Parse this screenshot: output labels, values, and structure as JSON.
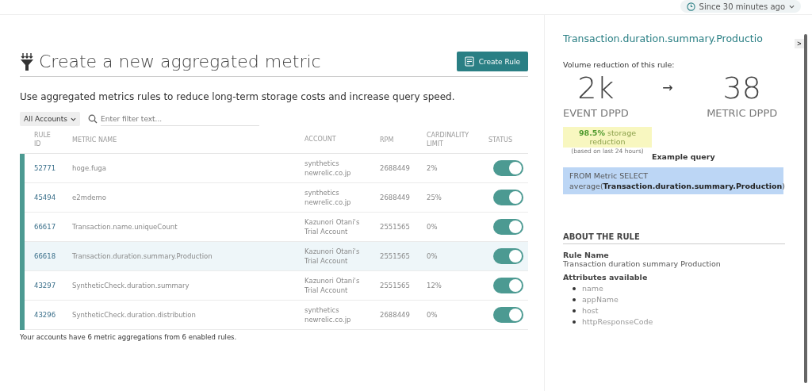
{
  "time_picker": {
    "label": "Since 30 minutes ago"
  },
  "header": {
    "title": "Create a new aggregated metric",
    "create_button": "Create Rule"
  },
  "description": "Use aggregated metrics rules to reduce long-term storage costs and increase query speed.",
  "filters": {
    "account_dropdown": "All Accounts",
    "search": {
      "placeholder": "Enter filter text..."
    }
  },
  "table": {
    "columns": [
      "RULE ID",
      "METRIC NAME",
      "ACCOUNT",
      "RPM",
      "CARDINALITY LIMIT",
      "STATUS"
    ],
    "rows": [
      {
        "rule_id": "52771",
        "metric_name": "hoge.fuga",
        "account": [
          "synthetics",
          "newrelic.co.jp"
        ],
        "rpm": "2688449",
        "cardinality_limit": "2%",
        "enabled": true,
        "selected": false
      },
      {
        "rule_id": "45494",
        "metric_name": "e2mdemo",
        "account": [
          "synthetics",
          "newrelic.co.jp"
        ],
        "rpm": "2688449",
        "cardinality_limit": "25%",
        "enabled": true,
        "selected": false
      },
      {
        "rule_id": "66617",
        "metric_name": "Transaction.name.uniqueCount",
        "account": [
          "Kazunori Otani's",
          "Trial Account"
        ],
        "rpm": "2551565",
        "cardinality_limit": "0%",
        "enabled": true,
        "selected": false
      },
      {
        "rule_id": "66618",
        "metric_name": "Transaction.duration.summary.Production",
        "account": [
          "Kazunori Otani's",
          "Trial Account"
        ],
        "rpm": "2551565",
        "cardinality_limit": "0%",
        "enabled": true,
        "selected": true
      },
      {
        "rule_id": "43297",
        "metric_name": "SyntheticCheck.duration.summary",
        "account": [
          "Kazunori Otani's",
          "Trial Account"
        ],
        "rpm": "2551565",
        "cardinality_limit": "12%",
        "enabled": true,
        "selected": false
      },
      {
        "rule_id": "43296",
        "metric_name": "SyntheticCheck.duration.distribution",
        "account": [
          "synthetics",
          "newrelic.co.jp"
        ],
        "rpm": "2688449",
        "cardinality_limit": "0%",
        "enabled": true,
        "selected": false
      }
    ],
    "footer": "Your accounts have 6 metric aggregations from 6 enabled rules."
  },
  "detail_panel": {
    "title": "Transaction.duration.summary.Productio",
    "volume_heading": "Volume reduction of this rule:",
    "event_value": "2k",
    "arrow": "→",
    "metric_value": "38",
    "event_label": "EVENT DPPD",
    "metric_label": "METRIC DPPD",
    "storage_reduction": "**98.5%** storage reduction",
    "storage_note": "(based on last 24 hours)",
    "query_heading": "Example query",
    "query": "FROM Metric SELECT average(**Transaction.duration.summary.Production**)",
    "about_heading": "ABOUT THE RULE",
    "rule_name_label": "Rule Name",
    "rule_name": "Transaction duration summary Production",
    "attributes_label": "Attributes available",
    "attributes": [
      "name",
      "appName",
      "host",
      "httpResponseCode"
    ]
  },
  "collapse_button": ">"
}
